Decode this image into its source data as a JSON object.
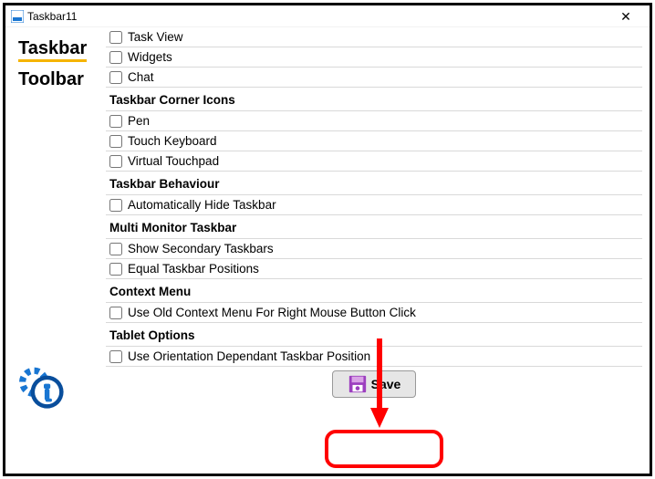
{
  "window": {
    "title": "Taskbar11"
  },
  "sidebar": {
    "tabs": [
      {
        "label": "Taskbar",
        "active": true
      },
      {
        "label": "Toolbar",
        "active": false
      }
    ]
  },
  "sections": {
    "s0_items": [
      "Task View",
      "Widgets",
      "Chat"
    ],
    "s1_title": "Taskbar Corner Icons",
    "s1_items": [
      "Pen",
      "Touch Keyboard",
      "Virtual Touchpad"
    ],
    "s2_title": "Taskbar Behaviour",
    "s2_items": [
      "Automatically Hide Taskbar"
    ],
    "s3_title": "Multi Monitor Taskbar",
    "s3_items": [
      "Show Secondary Taskbars",
      "Equal Taskbar Positions"
    ],
    "s4_title": "Context Menu",
    "s4_items": [
      "Use Old Context Menu For Right Mouse Button Click"
    ],
    "s5_title": "Tablet Options",
    "s5_items": [
      "Use Orientation Dependant Taskbar Position"
    ]
  },
  "buttons": {
    "save": "Save"
  },
  "annotation": {
    "highlight": true,
    "arrow": true
  }
}
